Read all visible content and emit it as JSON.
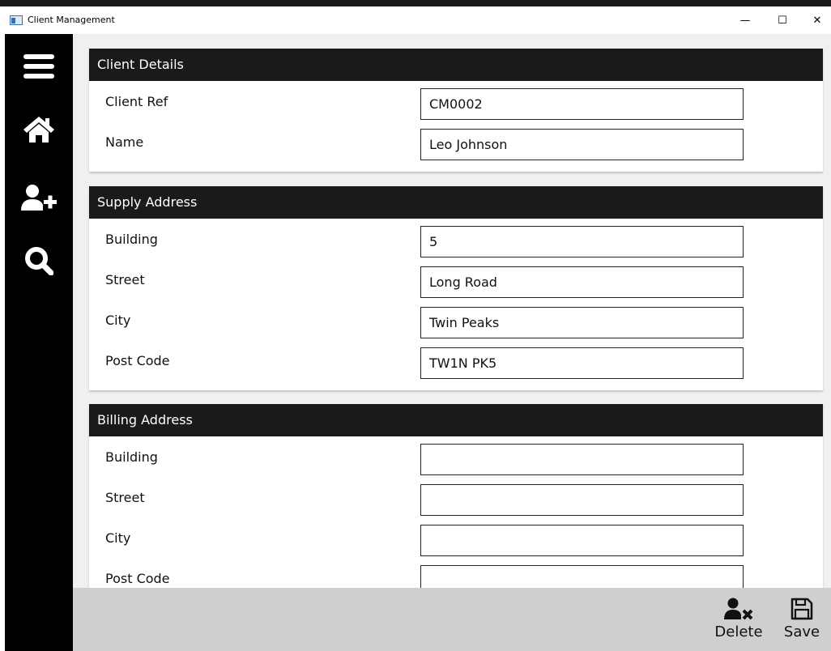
{
  "window": {
    "title": "Client Management",
    "minimize_glyph": "—",
    "maximize_glyph": "☐",
    "close_glyph": "✕"
  },
  "sidebar": {
    "items": [
      {
        "name": "menu",
        "icon": "hamburger-menu-icon"
      },
      {
        "name": "home",
        "icon": "home-icon"
      },
      {
        "name": "add-client",
        "icon": "add-user-icon"
      },
      {
        "name": "search",
        "icon": "search-icon"
      }
    ]
  },
  "client_details": {
    "heading": "Client Details",
    "client_ref_label": "Client Ref",
    "client_ref_value": "CM0002",
    "name_label": "Name",
    "name_value": "Leo Johnson"
  },
  "supply_address": {
    "heading": "Supply Address",
    "building_label": "Building",
    "building_value": "5",
    "street_label": "Street",
    "street_value": "Long Road",
    "city_label": "City",
    "city_value": "Twin Peaks",
    "postcode_label": "Post Code",
    "postcode_value": "TW1N PK5"
  },
  "billing_address": {
    "heading": "Billing Address",
    "building_label": "Building",
    "building_value": "",
    "street_label": "Street",
    "street_value": "",
    "city_label": "City",
    "city_value": "",
    "postcode_label": "Post Code",
    "postcode_value": ""
  },
  "actions": {
    "delete_label": "Delete",
    "delete_icon": "remove-user-icon",
    "save_label": "Save",
    "save_icon": "floppy-disk-icon"
  },
  "colors": {
    "sidebar_bg": "#000000",
    "header_bg": "#1a1a1a",
    "content_bg": "#f0f0f0",
    "bottombar_bg": "#cfcfcf"
  }
}
